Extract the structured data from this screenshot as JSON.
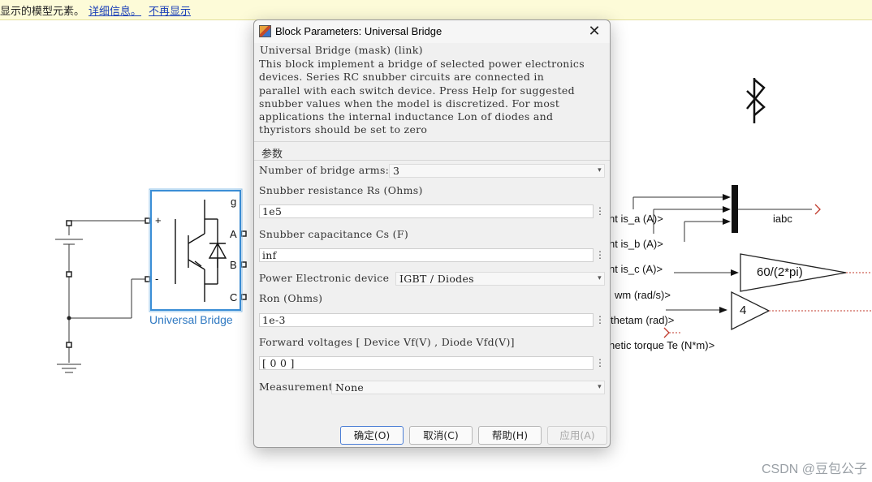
{
  "info_bar": {
    "message": "显示的模型元素。",
    "link_details": "详细信息。",
    "link_dismiss": "不再显示"
  },
  "diagram": {
    "block_name": "Universal Bridge",
    "bridge_ports": {
      "plus": "+",
      "minus": "-",
      "g": "g",
      "a": "A",
      "b": "B",
      "c": "C"
    },
    "signals": [
      "nt is_a (A)>",
      "nt is_b (A)>",
      "nt is_c (A)>",
      "wm (rad/s)>",
      "thetam (rad)>",
      "netic torque Te (N*m)>"
    ],
    "mux_output_label": "iabc",
    "gain_speed": "60/(2*pi)",
    "gain_pole": "4"
  },
  "dialog": {
    "title": "Block Parameters: Universal Bridge",
    "close_glyph": "✕",
    "mask_header": "Universal Bridge (mask) (link)",
    "description_lines": [
      "This block implement a bridge of selected power electronics",
      "devices.  Series RC snubber circuits are connected in",
      "parallel with each switch device.  Press Help for suggested",
      "snubber values when the model is discretized. For most",
      "applications the internal inductance Lon of diodes and",
      "thyristors should be set to zero"
    ],
    "group_label": "参数",
    "params": {
      "arms_label": "Number of bridge arms:",
      "arms_value": "3",
      "rs_label": "Snubber resistance Rs (Ohms)",
      "rs_value": "1e5",
      "cs_label": "Snubber capacitance Cs (F)",
      "cs_value": "inf",
      "device_label": "Power Electronic device",
      "device_value": "IGBT / Diodes",
      "ron_label": "Ron (Ohms)",
      "ron_value": "1e-3",
      "vf_label": "Forward voltages  [ Device Vf(V) , Diode Vfd(V)]",
      "vf_value": "[  0  0  ]",
      "meas_label": "Measurements",
      "meas_value": "None"
    },
    "buttons": {
      "ok": "确定(O)",
      "cancel": "取消(C)",
      "help": "帮助(H)",
      "apply": "应用(A)"
    },
    "dots_glyph": "⋮",
    "combo_arrow": "▾"
  },
  "watermark": "CSDN @豆包公子"
}
